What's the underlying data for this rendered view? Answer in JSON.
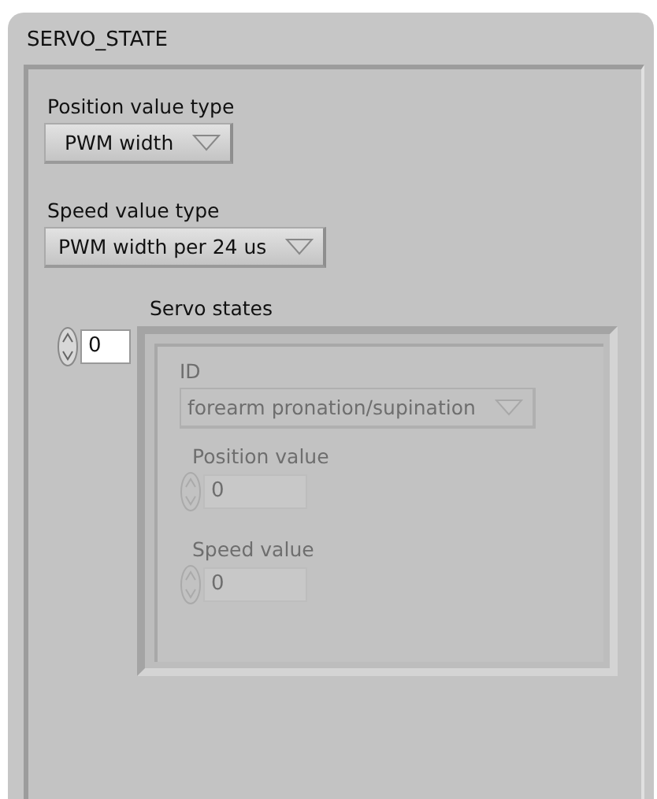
{
  "cluster": {
    "title": "SERVO_STATE",
    "position_value_type": {
      "label": "Position value type",
      "value": "PWM width"
    },
    "speed_value_type": {
      "label": "Speed value type",
      "value": "PWM width per 24 us"
    },
    "servo_states": {
      "label": "Servo states",
      "index": "0",
      "disabled": true,
      "element": {
        "id": {
          "label": "ID",
          "value": "forearm pronation/supination"
        },
        "position_value": {
          "label": "Position value",
          "value": "0"
        },
        "speed_value": {
          "label": "Speed value",
          "value": "0"
        }
      }
    }
  }
}
